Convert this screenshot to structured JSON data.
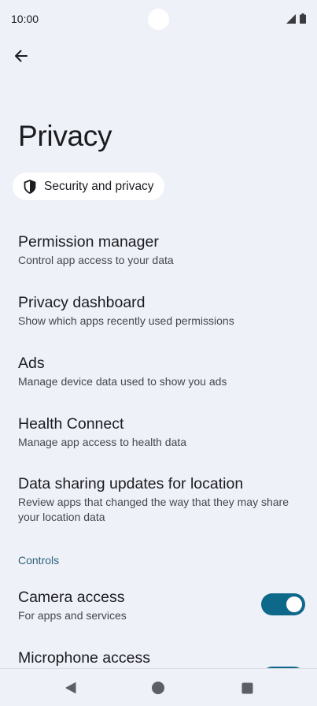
{
  "status_bar": {
    "time": "10:00"
  },
  "header": {
    "title": "Privacy"
  },
  "chip": {
    "label": "Security and privacy"
  },
  "items": [
    {
      "title": "Permission manager",
      "subtitle": "Control app access to your data"
    },
    {
      "title": "Privacy dashboard",
      "subtitle": "Show which apps recently used permissions"
    },
    {
      "title": "Ads",
      "subtitle": "Manage device data used to show you ads"
    },
    {
      "title": "Health Connect",
      "subtitle": "Manage app access to health data"
    },
    {
      "title": "Data sharing updates for location",
      "subtitle": "Review apps that changed the way that they may share your location data"
    }
  ],
  "controls": {
    "header": "Controls",
    "camera": {
      "title": "Camera access",
      "subtitle": "For apps and services",
      "enabled": true
    },
    "microphone": {
      "title": "Microphone access",
      "enabled": true
    }
  },
  "colors": {
    "background": "#eff1f9",
    "accent": "#0e6889",
    "section_header": "#2c6279"
  },
  "icons": {
    "back": "arrow-left-icon",
    "chip": "shield-icon",
    "nav_back": "triangle-back-icon",
    "nav_home": "circle-home-icon",
    "nav_recents": "square-recents-icon"
  }
}
